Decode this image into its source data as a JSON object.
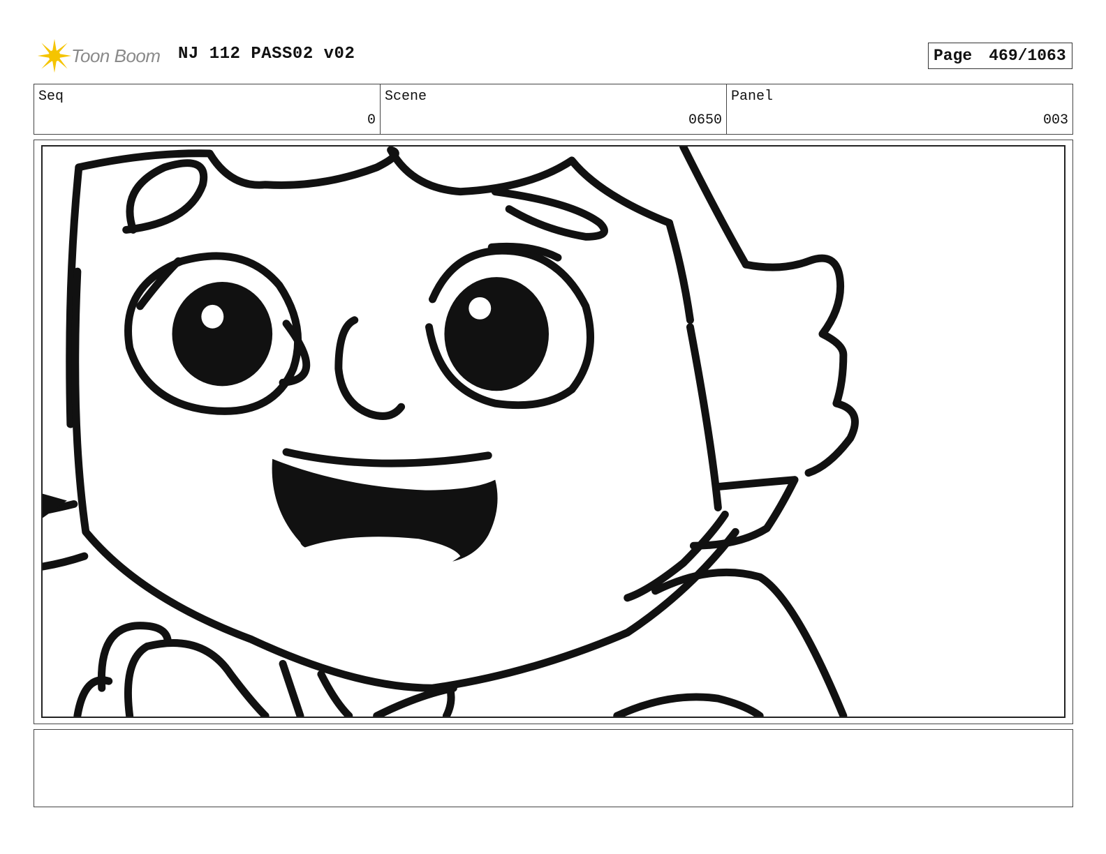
{
  "header": {
    "logo_text": "Toon Boom",
    "title": "NJ 112 PASS02 v02",
    "page_label": "Page",
    "page_number": "469/1063"
  },
  "info": {
    "seq_label": "Seq",
    "seq_value": "0",
    "scene_label": "Scene",
    "scene_value": "0650",
    "panel_label": "Panel",
    "panel_value": "003"
  },
  "notes": {
    "text": ""
  },
  "colors": {
    "logo_flare": "#f5c400",
    "logo_text": "#8a8a8a",
    "ink": "#111111"
  }
}
